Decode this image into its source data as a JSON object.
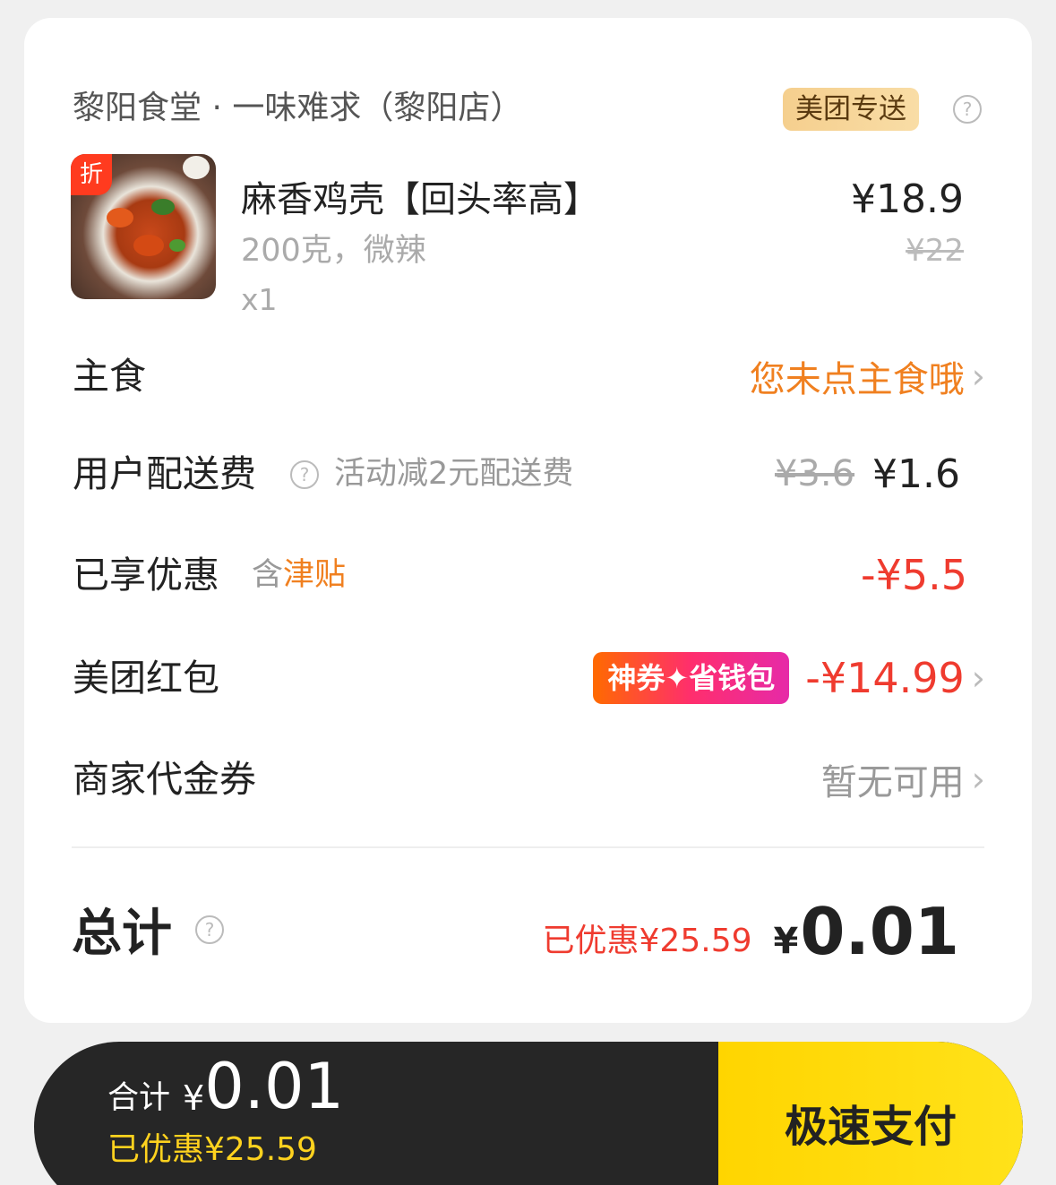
{
  "shop": {
    "name": "黎阳食堂 · 一味难求（黎阳店）",
    "delivery_badge": "美团专送",
    "help_icon": "?"
  },
  "item": {
    "discount_tag": "折",
    "name": "麻香鸡壳【回头率高】",
    "spec": "200克，微辣",
    "qty": "x1",
    "price": "¥18.9",
    "original_price": "¥22"
  },
  "staple": {
    "label": "主食",
    "value": "您未点主食哦",
    "chevron": "›"
  },
  "delivery_fee": {
    "label": "用户配送费",
    "help_icon": "?",
    "note": "活动减2元配送费",
    "original": "¥3.6",
    "current": "¥1.6"
  },
  "discount": {
    "label": "已享优惠",
    "note_prefix": "含",
    "note_highlight": "津贴",
    "value": "-¥5.5"
  },
  "red_packet": {
    "label": "美团红包",
    "promo_tag": "神券✦省钱包",
    "value": "-¥14.99",
    "chevron": "›"
  },
  "merchant_voucher": {
    "label": "商家代金券",
    "value": "暂无可用",
    "chevron": "›"
  },
  "total": {
    "label": "总计",
    "help_icon": "?",
    "saved": "已优惠¥25.59",
    "yen": "¥",
    "amount": "0.01"
  },
  "paybar": {
    "sum_label": "合计",
    "yen": "¥",
    "amount": "0.01",
    "saved": "已优惠¥25.59",
    "pay_button": "极速支付"
  },
  "colors": {
    "accent_orange": "#f08020",
    "discount_red": "#ef3b2f",
    "pay_yellow": "#ffd500",
    "paybar_dark": "#262626"
  }
}
